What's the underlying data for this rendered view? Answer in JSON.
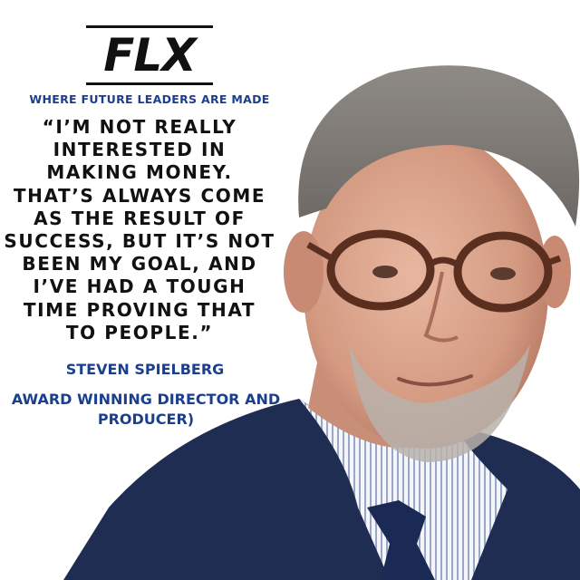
{
  "brand": {
    "logo_text": "FLX",
    "tagline": "WHERE FUTURE LEADERS ARE MADE"
  },
  "quote": {
    "lines": [
      "“I’M NOT REALLY",
      "INTERESTED IN",
      "MAKING MONEY.",
      "THAT’S ALWAYS COME",
      "AS THE RESULT OF",
      "SUCCESS, BUT IT’S NOT",
      "BEEN MY GOAL, AND",
      "I’VE HAD A TOUGH",
      "TIME PROVING THAT",
      "TO PEOPLE.”"
    ]
  },
  "attribution": {
    "name": "STEVEN SPIELBERG",
    "title_lines": [
      "AWARD WINNING DIRECTOR AND",
      "PRODUCER)"
    ]
  },
  "colors": {
    "accent_blue": "#1a3f8f",
    "text_dark": "#111111",
    "background": "#ffffff"
  }
}
